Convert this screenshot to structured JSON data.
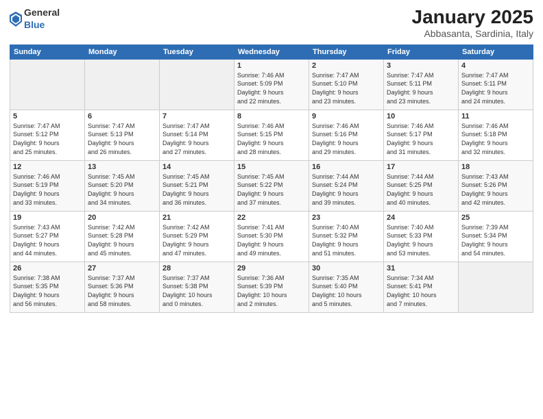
{
  "logo": {
    "general": "General",
    "blue": "Blue"
  },
  "header": {
    "month": "January 2025",
    "location": "Abbasanta, Sardinia, Italy"
  },
  "weekdays": [
    "Sunday",
    "Monday",
    "Tuesday",
    "Wednesday",
    "Thursday",
    "Friday",
    "Saturday"
  ],
  "weeks": [
    [
      {
        "day": "",
        "info": ""
      },
      {
        "day": "",
        "info": ""
      },
      {
        "day": "",
        "info": ""
      },
      {
        "day": "1",
        "info": "Sunrise: 7:46 AM\nSunset: 5:09 PM\nDaylight: 9 hours\nand 22 minutes."
      },
      {
        "day": "2",
        "info": "Sunrise: 7:47 AM\nSunset: 5:10 PM\nDaylight: 9 hours\nand 23 minutes."
      },
      {
        "day": "3",
        "info": "Sunrise: 7:47 AM\nSunset: 5:11 PM\nDaylight: 9 hours\nand 23 minutes."
      },
      {
        "day": "4",
        "info": "Sunrise: 7:47 AM\nSunset: 5:11 PM\nDaylight: 9 hours\nand 24 minutes."
      }
    ],
    [
      {
        "day": "5",
        "info": "Sunrise: 7:47 AM\nSunset: 5:12 PM\nDaylight: 9 hours\nand 25 minutes."
      },
      {
        "day": "6",
        "info": "Sunrise: 7:47 AM\nSunset: 5:13 PM\nDaylight: 9 hours\nand 26 minutes."
      },
      {
        "day": "7",
        "info": "Sunrise: 7:47 AM\nSunset: 5:14 PM\nDaylight: 9 hours\nand 27 minutes."
      },
      {
        "day": "8",
        "info": "Sunrise: 7:46 AM\nSunset: 5:15 PM\nDaylight: 9 hours\nand 28 minutes."
      },
      {
        "day": "9",
        "info": "Sunrise: 7:46 AM\nSunset: 5:16 PM\nDaylight: 9 hours\nand 29 minutes."
      },
      {
        "day": "10",
        "info": "Sunrise: 7:46 AM\nSunset: 5:17 PM\nDaylight: 9 hours\nand 31 minutes."
      },
      {
        "day": "11",
        "info": "Sunrise: 7:46 AM\nSunset: 5:18 PM\nDaylight: 9 hours\nand 32 minutes."
      }
    ],
    [
      {
        "day": "12",
        "info": "Sunrise: 7:46 AM\nSunset: 5:19 PM\nDaylight: 9 hours\nand 33 minutes."
      },
      {
        "day": "13",
        "info": "Sunrise: 7:45 AM\nSunset: 5:20 PM\nDaylight: 9 hours\nand 34 minutes."
      },
      {
        "day": "14",
        "info": "Sunrise: 7:45 AM\nSunset: 5:21 PM\nDaylight: 9 hours\nand 36 minutes."
      },
      {
        "day": "15",
        "info": "Sunrise: 7:45 AM\nSunset: 5:22 PM\nDaylight: 9 hours\nand 37 minutes."
      },
      {
        "day": "16",
        "info": "Sunrise: 7:44 AM\nSunset: 5:24 PM\nDaylight: 9 hours\nand 39 minutes."
      },
      {
        "day": "17",
        "info": "Sunrise: 7:44 AM\nSunset: 5:25 PM\nDaylight: 9 hours\nand 40 minutes."
      },
      {
        "day": "18",
        "info": "Sunrise: 7:43 AM\nSunset: 5:26 PM\nDaylight: 9 hours\nand 42 minutes."
      }
    ],
    [
      {
        "day": "19",
        "info": "Sunrise: 7:43 AM\nSunset: 5:27 PM\nDaylight: 9 hours\nand 44 minutes."
      },
      {
        "day": "20",
        "info": "Sunrise: 7:42 AM\nSunset: 5:28 PM\nDaylight: 9 hours\nand 45 minutes."
      },
      {
        "day": "21",
        "info": "Sunrise: 7:42 AM\nSunset: 5:29 PM\nDaylight: 9 hours\nand 47 minutes."
      },
      {
        "day": "22",
        "info": "Sunrise: 7:41 AM\nSunset: 5:30 PM\nDaylight: 9 hours\nand 49 minutes."
      },
      {
        "day": "23",
        "info": "Sunrise: 7:40 AM\nSunset: 5:32 PM\nDaylight: 9 hours\nand 51 minutes."
      },
      {
        "day": "24",
        "info": "Sunrise: 7:40 AM\nSunset: 5:33 PM\nDaylight: 9 hours\nand 53 minutes."
      },
      {
        "day": "25",
        "info": "Sunrise: 7:39 AM\nSunset: 5:34 PM\nDaylight: 9 hours\nand 54 minutes."
      }
    ],
    [
      {
        "day": "26",
        "info": "Sunrise: 7:38 AM\nSunset: 5:35 PM\nDaylight: 9 hours\nand 56 minutes."
      },
      {
        "day": "27",
        "info": "Sunrise: 7:37 AM\nSunset: 5:36 PM\nDaylight: 9 hours\nand 58 minutes."
      },
      {
        "day": "28",
        "info": "Sunrise: 7:37 AM\nSunset: 5:38 PM\nDaylight: 10 hours\nand 0 minutes."
      },
      {
        "day": "29",
        "info": "Sunrise: 7:36 AM\nSunset: 5:39 PM\nDaylight: 10 hours\nand 2 minutes."
      },
      {
        "day": "30",
        "info": "Sunrise: 7:35 AM\nSunset: 5:40 PM\nDaylight: 10 hours\nand 5 minutes."
      },
      {
        "day": "31",
        "info": "Sunrise: 7:34 AM\nSunset: 5:41 PM\nDaylight: 10 hours\nand 7 minutes."
      },
      {
        "day": "",
        "info": ""
      }
    ]
  ]
}
